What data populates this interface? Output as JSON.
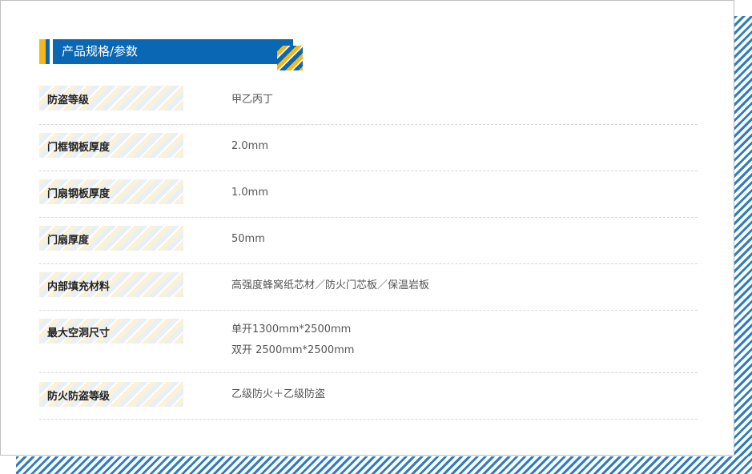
{
  "header": {
    "title": "产品规格/参数"
  },
  "colors": {
    "accent_blue": "#0a67b3",
    "accent_yellow": "#f6b817",
    "stripe_blue": "#2f7cc6"
  },
  "specs": [
    {
      "label": "防盗等级",
      "values": [
        "甲乙丙丁"
      ]
    },
    {
      "label": "门框钢板厚度",
      "values": [
        "2.0mm"
      ]
    },
    {
      "label": "门扇钢板厚度",
      "values": [
        "1.0mm"
      ]
    },
    {
      "label": "门扇厚度",
      "values": [
        "50mm"
      ]
    },
    {
      "label": "内部填充材料",
      "values": [
        "高强度蜂窝纸芯材／防火门芯板／保温岩板"
      ]
    },
    {
      "label": "最大空洞尺寸",
      "values": [
        "单开1300mm*2500mm",
        "双开 2500mm*2500mm"
      ]
    },
    {
      "label": "防火防盗等级",
      "values": [
        "乙级防火＋乙级防盗"
      ]
    }
  ]
}
